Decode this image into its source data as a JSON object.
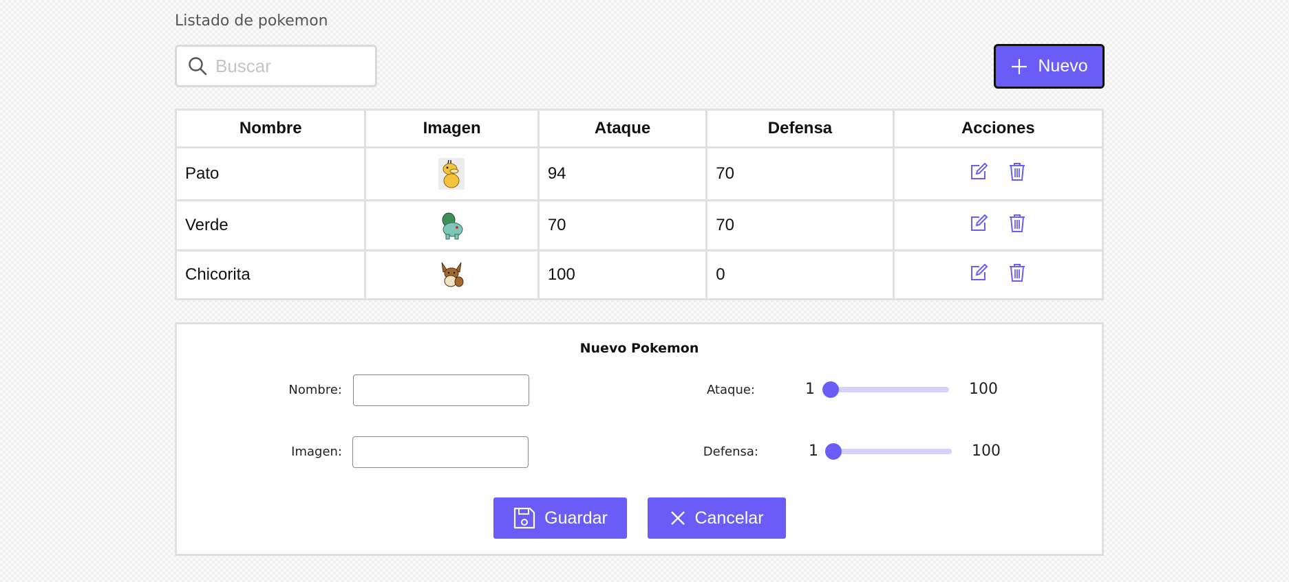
{
  "page": {
    "title": "Listado de pokemon"
  },
  "search": {
    "placeholder": "Buscar",
    "icon": "search-icon"
  },
  "toolbar": {
    "new_label": "Nuevo",
    "new_icon": "plus-icon",
    "accent": "#6a5cf6"
  },
  "table": {
    "headers": [
      "Nombre",
      "Imagen",
      "Ataque",
      "Defensa",
      "Acciones"
    ],
    "rows": [
      {
        "nombre": "Pato",
        "imagen": "psyduck-sprite",
        "ataque": "94",
        "defensa": "70"
      },
      {
        "nombre": "Verde",
        "imagen": "bulbasaur-sprite",
        "ataque": "70",
        "defensa": "70"
      },
      {
        "nombre": "Chicorita",
        "imagen": "eevee-sprite",
        "ataque": "100",
        "defensa": "0"
      }
    ],
    "actions": {
      "edit_icon": "edit-icon",
      "delete_icon": "trash-icon"
    }
  },
  "form": {
    "title": "Nuevo Pokemon",
    "nombre_label": "Nombre:",
    "imagen_label": "Imagen:",
    "ataque_label": "Ataque:",
    "defensa_label": "Defensa:",
    "nombre_value": "",
    "imagen_value": "",
    "ataque": {
      "min": "1",
      "max": "100",
      "value": 1
    },
    "defensa": {
      "min": "1",
      "max": "100",
      "value": 1
    },
    "save_label": "Guardar",
    "save_icon": "floppy-disk-icon",
    "cancel_label": "Cancelar",
    "cancel_icon": "close-icon"
  }
}
